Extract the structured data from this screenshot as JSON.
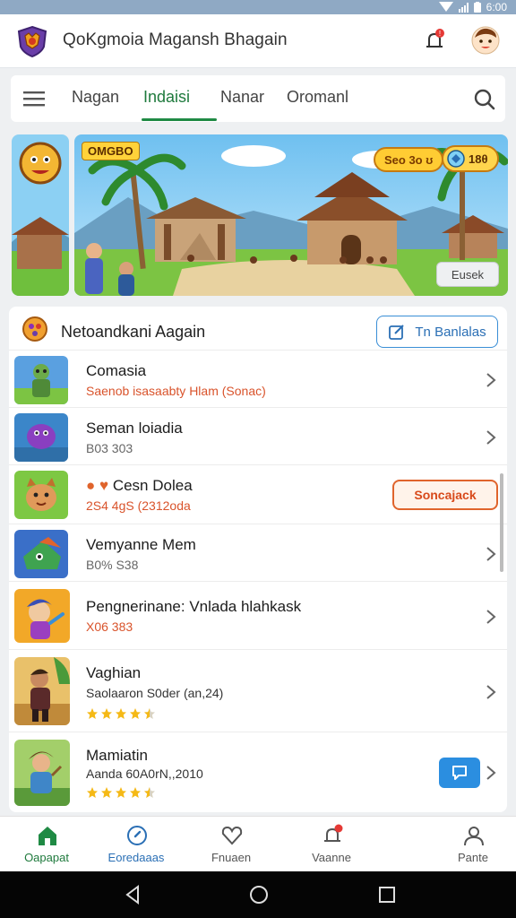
{
  "status_bar": {
    "time": "6:00"
  },
  "app_bar": {
    "title": "QoKgmoia Magansh Bhagain"
  },
  "tabs": [
    {
      "label": "Nagan",
      "active": false
    },
    {
      "label": "Indaisi",
      "active": true
    },
    {
      "label": "Nanar",
      "active": false
    },
    {
      "label": "Oromanl",
      "active": false
    }
  ],
  "banner": {
    "badge": "OMGBO",
    "pill_left": "Seo 3o ʊ",
    "pill_right": "18θ",
    "button": "Eusek"
  },
  "section": {
    "title": "Netoandkani Aagain",
    "button": "Tn Banlalas"
  },
  "rows": [
    {
      "title": "Comasia",
      "subtitle": "Saenob isasaabty Hlam (Sonac)",
      "subtitle_color": "#d9532b"
    },
    {
      "title": "Seman loiadia",
      "subtitle": "B03 303"
    },
    {
      "title": "Cesn Dolea",
      "subtitle": "2S4 4gS (2312oda",
      "subtitle_color": "#d9532b",
      "action": "Soncajack"
    },
    {
      "title": "Vemyanne Mem",
      "subtitle": "B0% S38"
    },
    {
      "title": "Pengnerinane: Vnlada hlahkask",
      "subtitle": "X06 383",
      "subtitle_color": "#d9532b"
    },
    {
      "title": "Vaghian",
      "subtitle": "Saolaaron S0der (an,24)",
      "rating": 4.5
    },
    {
      "title": "Mamiatin",
      "subtitle": "Aanda 60A0rN,,2010",
      "rating": 4.5
    }
  ],
  "bottom_nav": [
    {
      "label": "Oapapat",
      "icon": "home-icon"
    },
    {
      "label": "Eoredaaas",
      "icon": "compass-icon"
    },
    {
      "label": "Fnuaen",
      "icon": "heart-icon"
    },
    {
      "label": "Vaanne",
      "icon": "bell-icon"
    },
    {
      "label": "Pante",
      "icon": "profile-icon"
    }
  ],
  "colors": {
    "accent_green": "#1f7a3d",
    "accent_blue": "#2a6fb5",
    "accent_orange": "#e0642c",
    "star": "#f5b916"
  }
}
